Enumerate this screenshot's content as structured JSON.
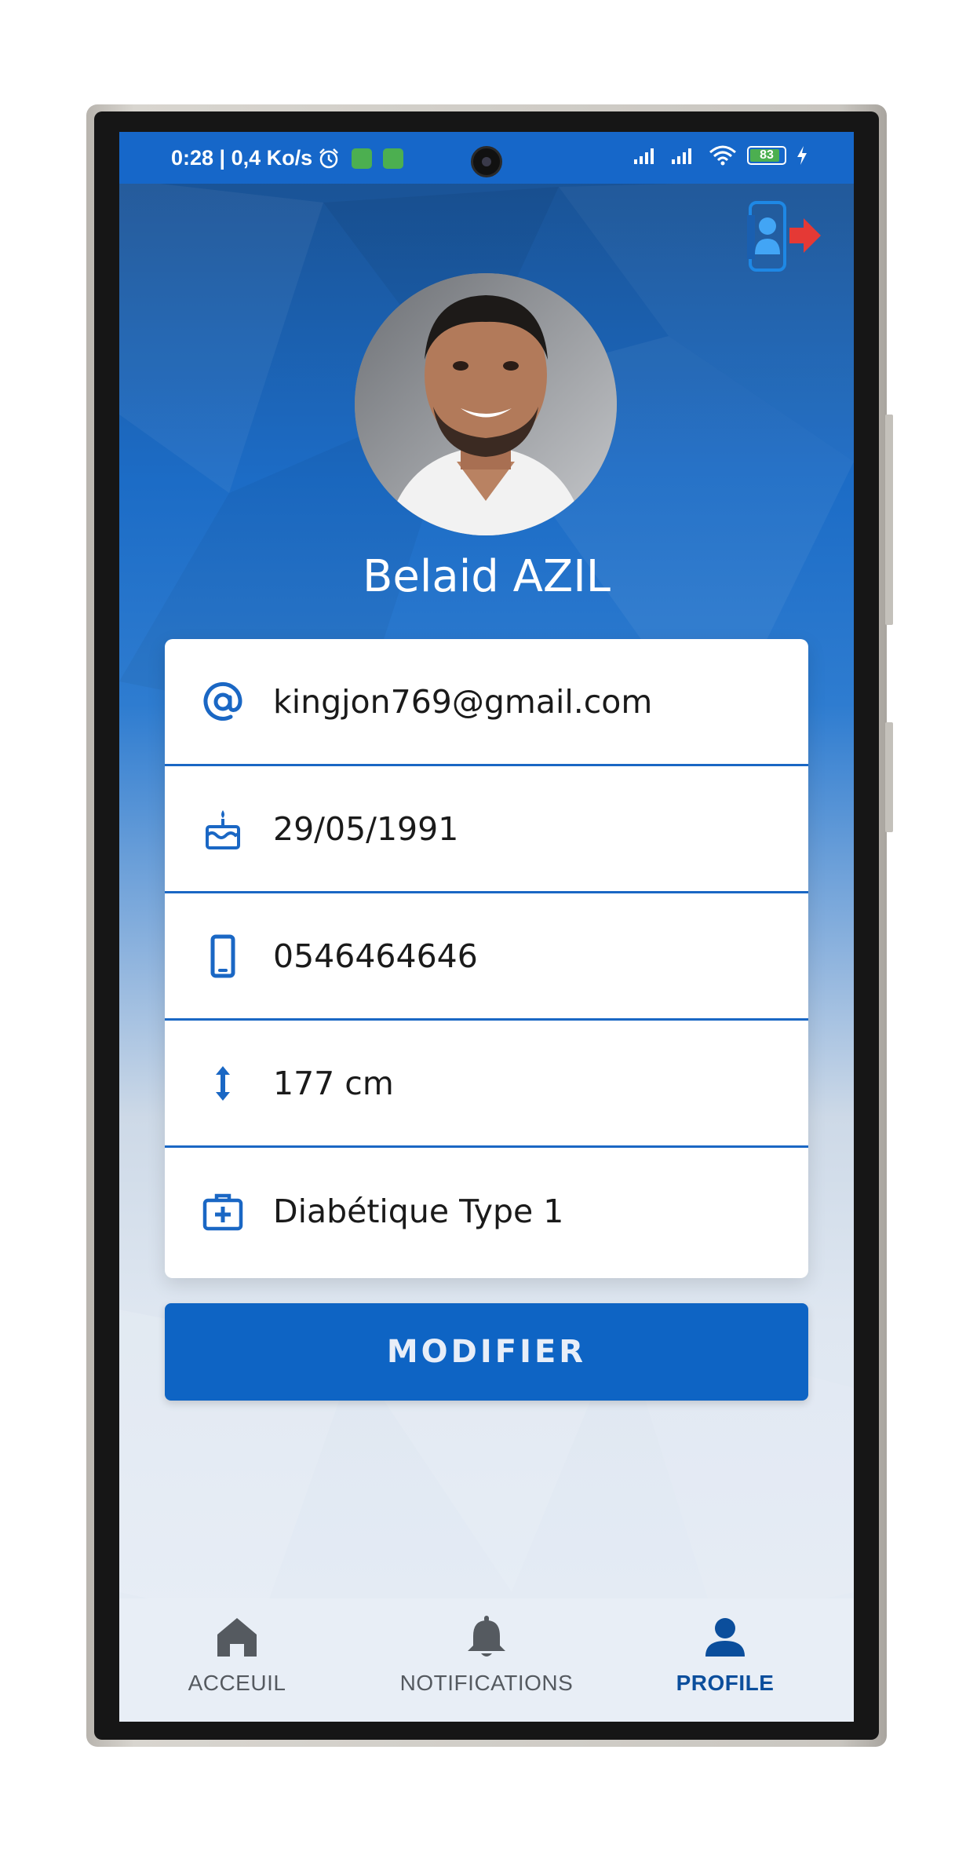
{
  "status_bar": {
    "time_speed": "0:28 | 0,4 Ko/s",
    "battery": "83"
  },
  "profile": {
    "name": "Belaid AZIL",
    "email": "kingjon769@gmail.com",
    "birthdate": "29/05/1991",
    "phone": "0546464646",
    "height": "177 cm",
    "condition": "Diabétique Type 1"
  },
  "actions": {
    "modify_label": "MODIFIER"
  },
  "bottom_nav": {
    "items": [
      {
        "label": "ACCEUIL",
        "icon": "home-icon",
        "active": false
      },
      {
        "label": "NOTIFICATIONS",
        "icon": "bell-icon",
        "active": false
      },
      {
        "label": "PROFILE",
        "icon": "person-icon",
        "active": true
      }
    ]
  },
  "colors": {
    "primary": "#0e64c4",
    "status_bar": "#1667c9",
    "nav_active": "#0b4e9c",
    "logout_arrow": "#e53935"
  }
}
